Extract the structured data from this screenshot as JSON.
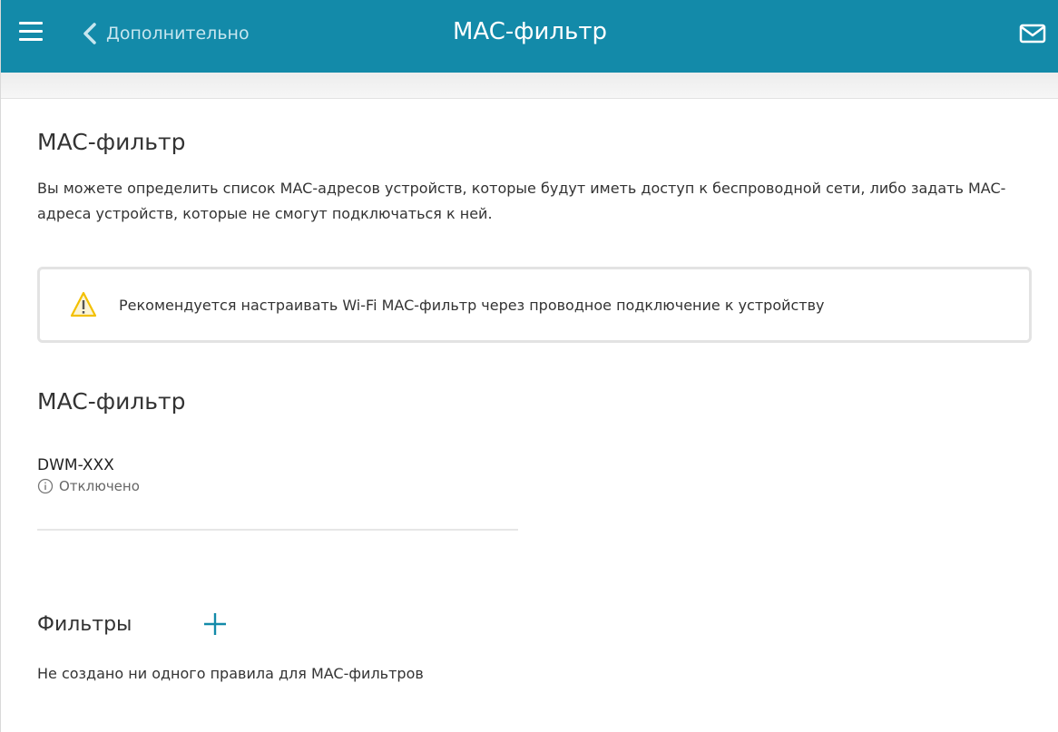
{
  "header": {
    "back_label": "Дополнительно",
    "title": "MAC-фильтр",
    "menu_icon": "hamburger-menu-icon",
    "back_icon": "chevron-left-icon",
    "mail_icon": "mail-envelope-icon"
  },
  "colors": {
    "header_bg": "#138aa9",
    "accent": "#138aa9",
    "warning": "#f3c000"
  },
  "page": {
    "title": "MAC-фильтр",
    "description": "Вы можете определить список MAC-адресов устройств, которые будут иметь доступ к беспроводной сети, либо задать MAC-адреса устройств, которые не смогут подключаться к ней.",
    "warning": {
      "icon": "warning-triangle-icon",
      "text": "Рекомендуется настраивать Wi-Fi MAC-фильтр через проводное подключение к устройству"
    },
    "mac_filter": {
      "title": "MAC-фильтр",
      "device_name": "DWM-XXX",
      "status_icon": "info-circle-icon",
      "status": "Отключено"
    },
    "filters": {
      "title": "Фильтры",
      "add_icon": "plus-icon",
      "empty_text": "Не создано ни одного правила для MAC-фильтров"
    }
  }
}
